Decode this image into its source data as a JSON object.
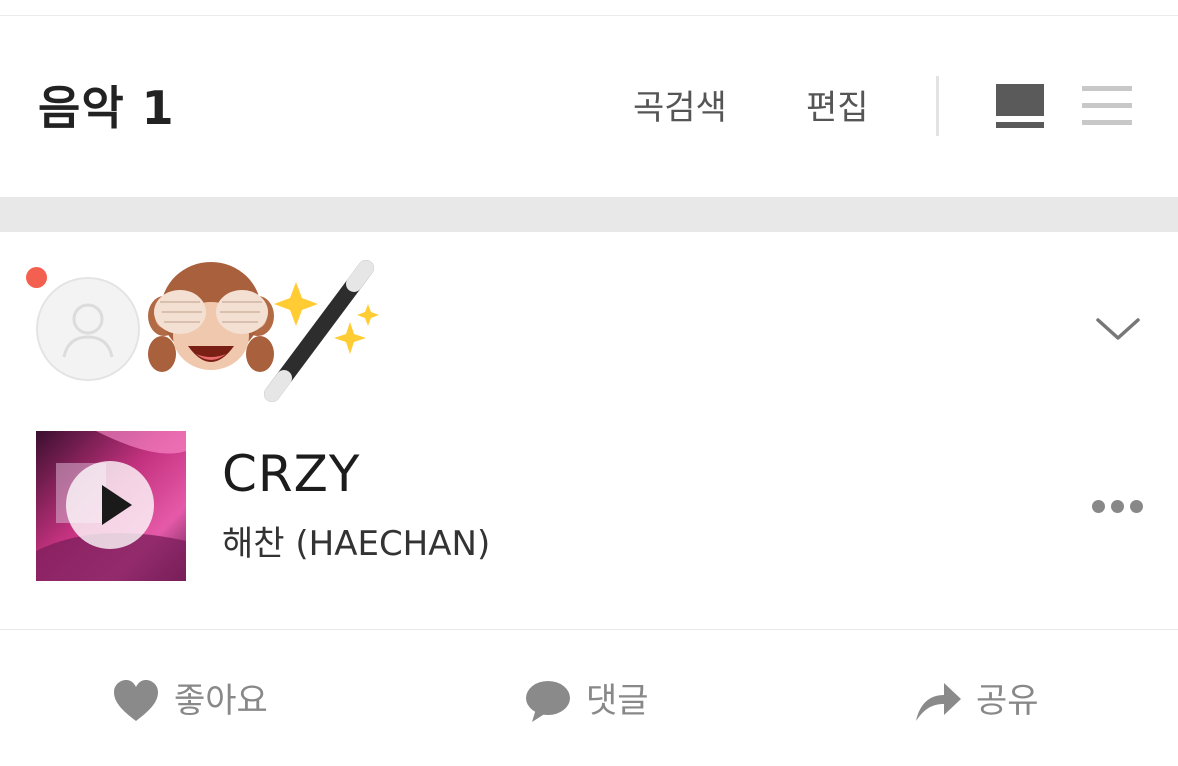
{
  "header": {
    "title": "음악 1",
    "search_label": "곡검색",
    "edit_label": "편집",
    "view_card_icon": "card-view-icon",
    "view_list_icon": "list-view-icon"
  },
  "post": {
    "avatar_icon": "default-user-avatar",
    "emoji": [
      "see-no-evil-monkey-emoji",
      "magic-wand-emoji"
    ],
    "notification_dot_color": "#f4604f",
    "expand_icon": "chevron-down-icon",
    "song": {
      "title": "CRZY",
      "artist": "해찬 (HAECHAN)",
      "play_icon": "play-icon",
      "more_icon": "more-horizontal-icon"
    }
  },
  "actions": {
    "like_label": "좋아요",
    "comment_label": "댓글",
    "share_label": "공유"
  },
  "colors": {
    "text_primary": "#222222",
    "text_secondary": "#888888",
    "divider": "#e8e8e8",
    "accent_dot": "#f4604f"
  }
}
